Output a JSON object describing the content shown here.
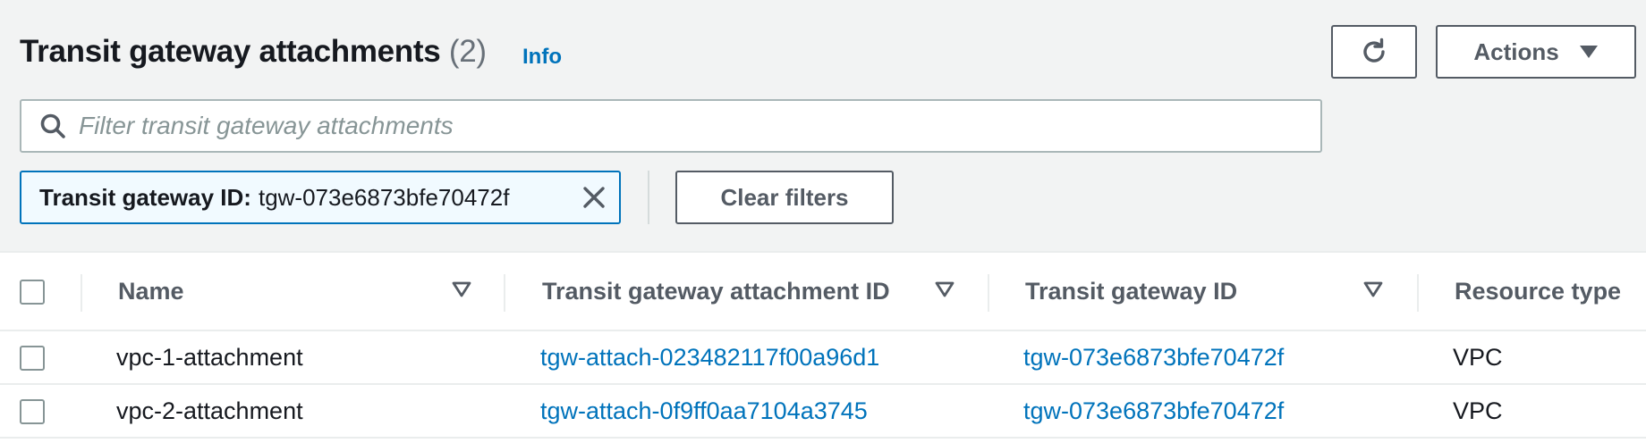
{
  "header": {
    "title": "Transit gateway attachments",
    "count": "(2)",
    "info": "Info",
    "actions_label": "Actions"
  },
  "search": {
    "placeholder": "Filter transit gateway attachments"
  },
  "filter_token": {
    "label": "Transit gateway ID:",
    "value": "tgw-073e6873bfe70472f"
  },
  "clear_filters_label": "Clear filters",
  "table": {
    "columns": [
      "Name",
      "Transit gateway attachment ID",
      "Transit gateway ID",
      "Resource type"
    ],
    "rows": [
      {
        "name": "vpc-1-attachment",
        "attachment_id": "tgw-attach-023482117f00a96d1",
        "tgw_id": "tgw-073e6873bfe70472f",
        "resource_type": "VPC"
      },
      {
        "name": "vpc-2-attachment",
        "attachment_id": "tgw-attach-0f9ff0aa7104a3745",
        "tgw_id": "tgw-073e6873bfe70472f",
        "resource_type": "VPC"
      }
    ]
  },
  "icons": {
    "refresh": "refresh-icon",
    "actions_caret": "caret-down-icon",
    "search": "search-icon",
    "token_remove": "close-icon",
    "sort": "sort-caret-icon"
  },
  "colors": {
    "link": "#0073bb",
    "token_bg": "#f1faff",
    "background": "#f2f3f3"
  }
}
